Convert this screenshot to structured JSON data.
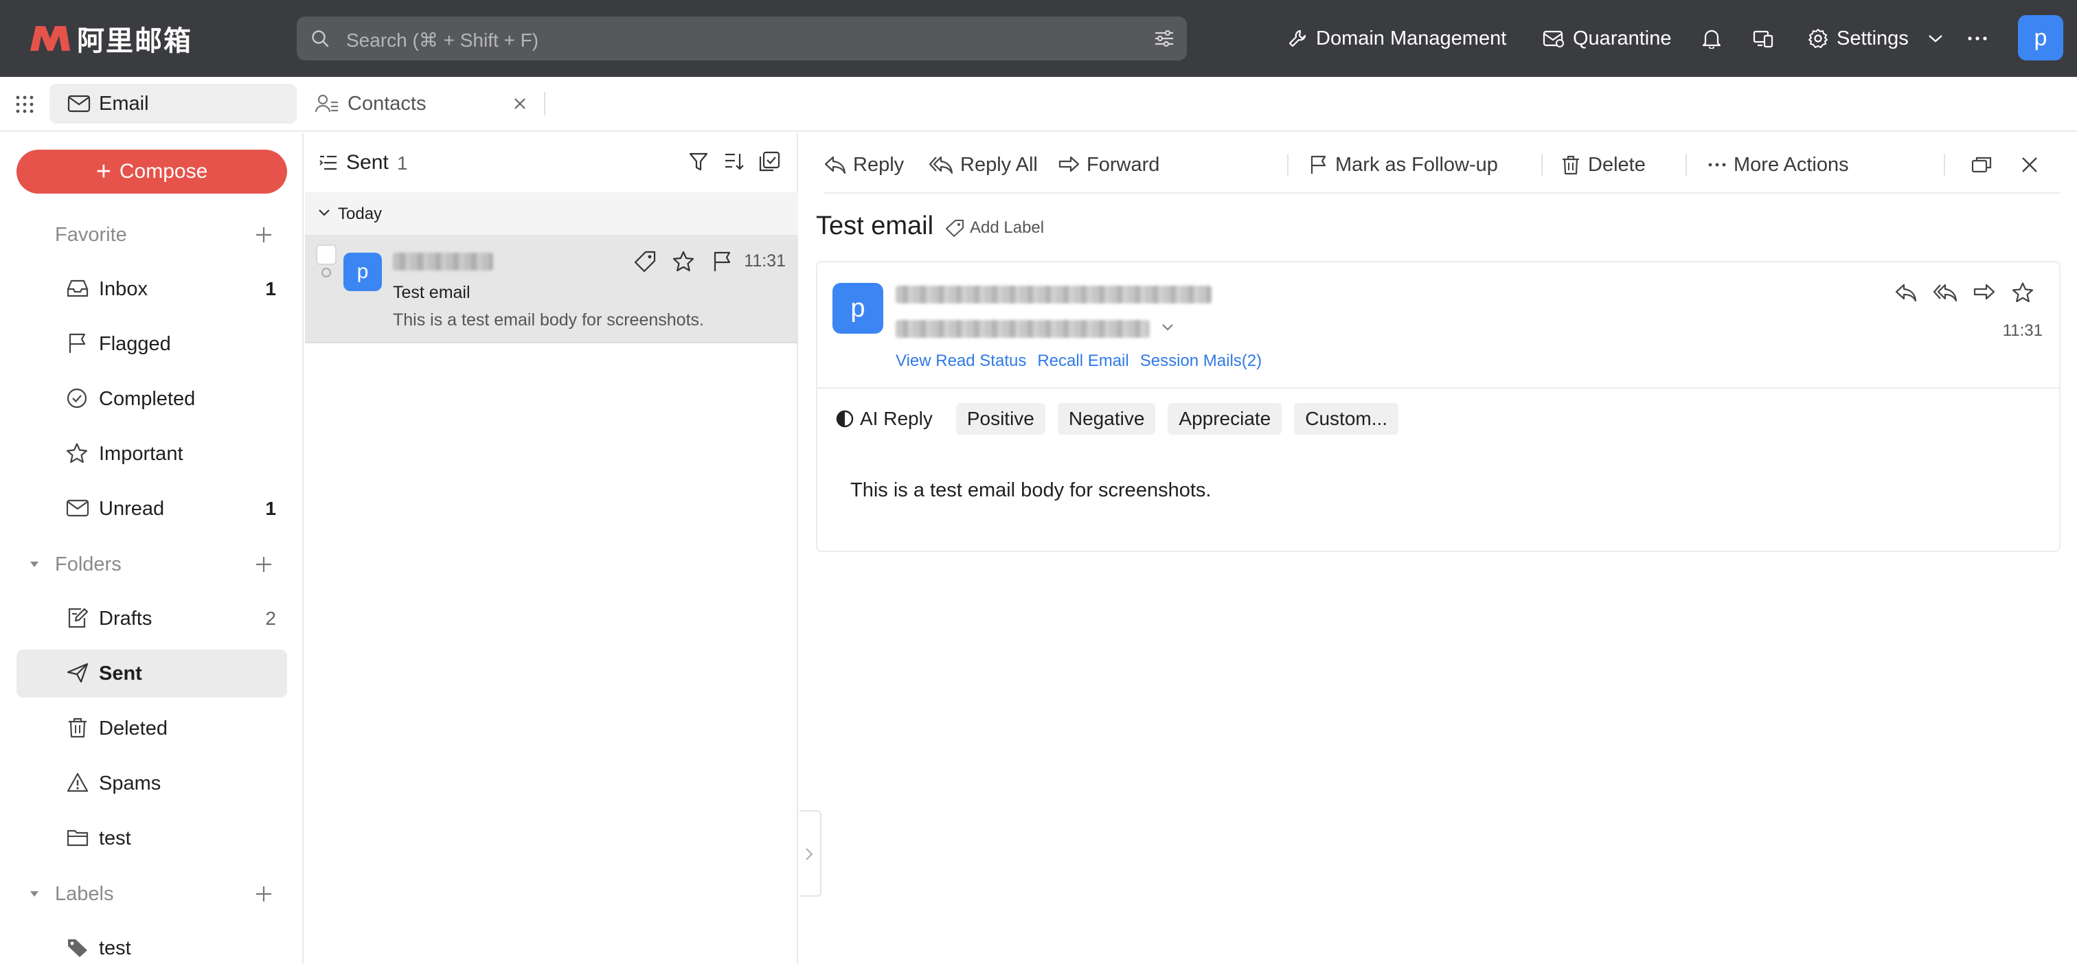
{
  "app": {
    "logo_text": "阿里邮箱",
    "brand_color": "#e5534b",
    "accent_color": "#3c86f3"
  },
  "topbar": {
    "search_placeholder": "Search (⌘ + Shift + F)",
    "domain_management": "Domain Management",
    "quarantine": "Quarantine",
    "settings": "Settings",
    "avatar_letter": "p"
  },
  "tabs": {
    "email": "Email",
    "contacts": "Contacts"
  },
  "sidebar": {
    "compose": "Compose",
    "favorite": "Favorite",
    "folders": "Folders",
    "labels": "Labels",
    "items": {
      "inbox": {
        "label": "Inbox",
        "count": "1"
      },
      "flagged": {
        "label": "Flagged"
      },
      "completed": {
        "label": "Completed"
      },
      "important": {
        "label": "Important"
      },
      "unread": {
        "label": "Unread",
        "count": "1"
      },
      "drafts": {
        "label": "Drafts",
        "count": "2"
      },
      "sent": {
        "label": "Sent"
      },
      "deleted": {
        "label": "Deleted"
      },
      "spams": {
        "label": "Spams"
      },
      "test_folder": {
        "label": "test"
      },
      "test_label": {
        "label": "test"
      }
    }
  },
  "list": {
    "title": "Sent",
    "count": "1",
    "group": "Today",
    "messages": [
      {
        "avatar": "p",
        "subject": "Test email",
        "preview": "This is a test email body for screenshots.",
        "time": "11:31"
      }
    ]
  },
  "reader": {
    "actions": {
      "reply": "Reply",
      "reply_all": "Reply All",
      "forward": "Forward",
      "follow_up": "Mark as Follow-up",
      "delete": "Delete",
      "more": "More Actions"
    },
    "subject": "Test email",
    "add_label": "Add Label",
    "avatar": "p",
    "time": "11:31",
    "links": {
      "read_status": "View Read Status",
      "recall": "Recall Email",
      "session": "Session Mails(2)"
    },
    "ai": {
      "label": "AI Reply",
      "chips": [
        "Positive",
        "Negative",
        "Appreciate",
        "Custom..."
      ]
    },
    "body": "This is a test email body for screenshots."
  }
}
